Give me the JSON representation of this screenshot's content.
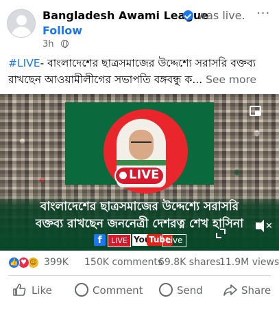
{
  "post": {
    "page_name": "Bangladesh Awami League",
    "status": "was live.",
    "follow_label": "Follow",
    "time": "3h",
    "more": "···",
    "hashtag": "#LIVE",
    "caption_text": "- বাংলাদেশের ছাত্রসমাজের উদ্দেশ্যে সরাসরি বক্তব্য রাখছেন আওয়ামীলীগের সভাপতি বঙ্গবন্ধু ক...",
    "see_more": " See more"
  },
  "video": {
    "live_badge": "LIVE",
    "banner_line1": "বাংলাদেশের ছাত্রসমাজের উদ্দেশ্যে সরাসরি",
    "banner_line2": "বক্তব্য রাখছেন জননেত্রী দেশরত্ন শেখ হাসিনা",
    "fb_logo": "f",
    "live_tag_1": "LIVE",
    "yt_you": "You",
    "yt_tube": "Tube",
    "live_tag_2": "Live",
    "icons": [
      "picture-in-picture-icon",
      "expand-icon",
      "mute-icon"
    ],
    "colors": {
      "flag_green": "#0a6a3d",
      "flag_red": "#e8262b",
      "live_red": "#d7192d"
    }
  },
  "stats": {
    "reactions": [
      "like",
      "love",
      "haha"
    ],
    "reaction_count": "399K",
    "comments": "150K comments",
    "shares": "69.8K shares",
    "views": "11.9M views"
  },
  "actions": {
    "like": "Like",
    "comment": "Comment",
    "send": "Send",
    "share": "Share"
  },
  "colors": {
    "accent": "#1877f2",
    "secondary_text": "#65676b"
  }
}
